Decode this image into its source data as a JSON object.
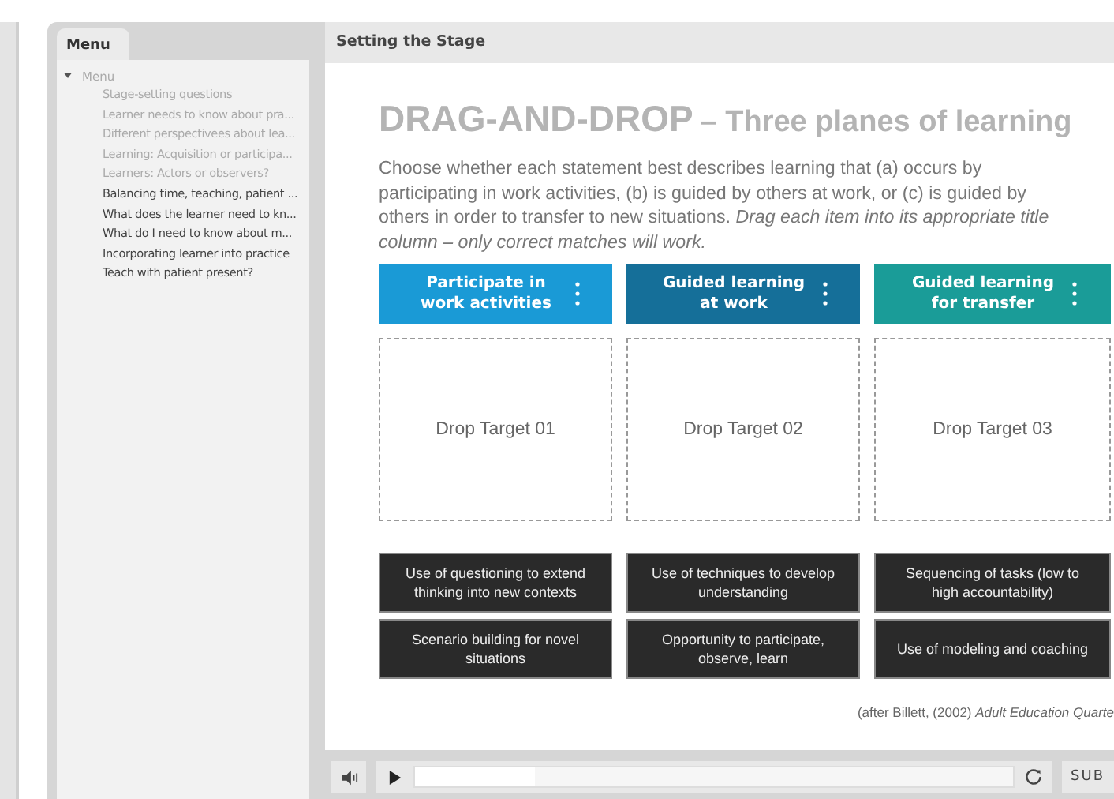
{
  "menu": {
    "tab": "Menu",
    "root": {
      "label": "Menu",
      "expanded": true,
      "children": [
        {
          "label": "Stage-setting questions",
          "visited": false
        },
        {
          "label": "Learner needs to know about pra...",
          "visited": false
        },
        {
          "label": "Different perspectivees about lea...",
          "visited": false
        },
        {
          "label": "Learning: Acquisition or participa...",
          "visited": false
        },
        {
          "label": "Learners: Actors or observers?",
          "visited": false
        },
        {
          "label": "Balancing time, teaching, patient ...",
          "visited": true
        },
        {
          "label": "What does the learner need to kn...",
          "visited": true
        },
        {
          "label": "What do I need to know about m...",
          "visited": true
        },
        {
          "label": "Incorporating learner into practice",
          "visited": true
        },
        {
          "label": "Teach with patient present?",
          "visited": true
        }
      ]
    }
  },
  "slide": {
    "title": "Setting the Stage",
    "heading": "DRAG-AND-DROP",
    "subheading": "– Three planes of learning",
    "instructions": "Choose whether each statement best describes learning that (a) occurs by participating in  work activities, (b) is guided by others at work, or (c) is guided by others in order to transfer to new situations.  *Drag each item into its appropriate title column – only correct matches will work.*",
    "columns": [
      {
        "title": "Participate in work activities",
        "color": "#1a9ad6",
        "target": "Drop Target 01"
      },
      {
        "title": "Guided learning at work",
        "color": "#156f99",
        "target": "Drop Target 02"
      },
      {
        "title": "Guided learning for transfer",
        "color": "#1a9c98",
        "target": "Drop Target 03"
      }
    ],
    "items": [
      "Use of questioning to extend thinking into new contexts",
      "Use of techniques to develop understanding",
      "Sequencing of tasks (low  to high accountability)",
      "Scenario building for novel situations",
      "Opportunity to participate, observe, learn",
      "Use of modeling and coaching"
    ],
    "citation": "(after Billett, (2002) *Adult Education Quarte*"
  },
  "player": {
    "progress": {
      "level": 0.2
    },
    "submit": "SUB"
  }
}
